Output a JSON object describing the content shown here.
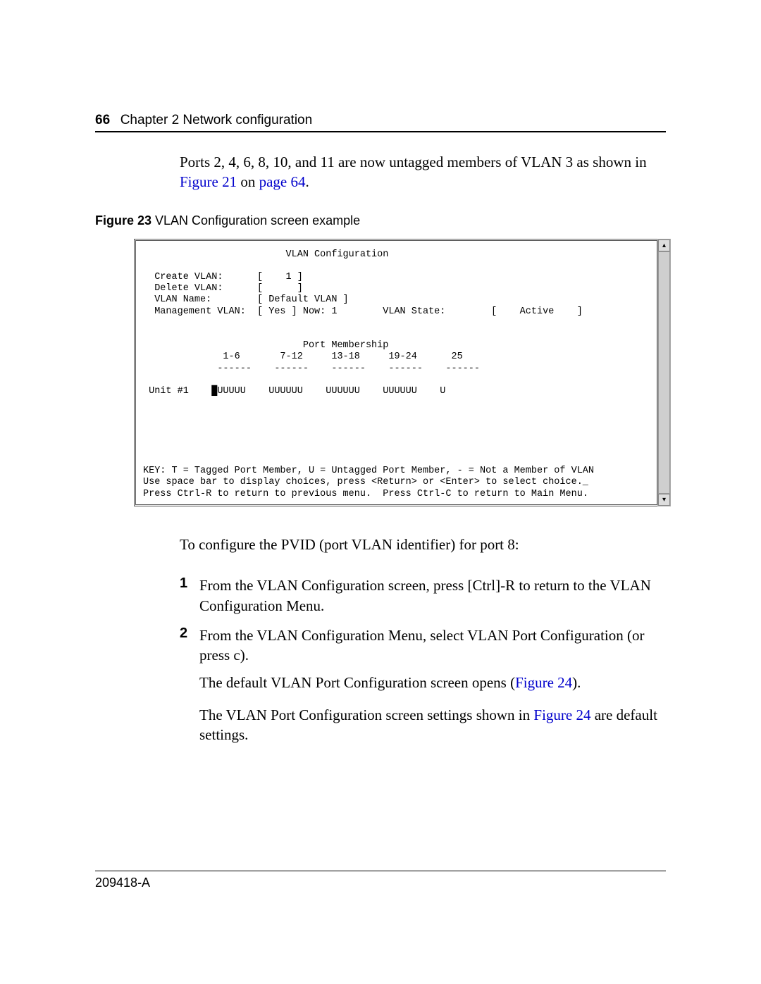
{
  "header": {
    "page_num": "66",
    "chapter": "Chapter 2  Network configuration"
  },
  "intro_para": {
    "line1_a": "Ports 2, 4, 6, 8, 10, and 11 are now untagged members of VLAN 3 as shown in ",
    "xref_fig": "Figure 21",
    "xref_on": " on ",
    "xref_page": "page 64",
    "line1_end": "."
  },
  "figure": {
    "label": "Figure 23",
    "caption": "   VLAN Configuration screen example"
  },
  "terminal_text": "                         VLAN Configuration\n\n  Create VLAN:      [    1 ]\n  Delete VLAN:      [      ]\n  VLAN Name:        [ Default VLAN ]\n  Management VLAN:  [ Yes ] Now: 1        VLAN State:        [    Active    ]\n\n\n                            Port Membership\n              1-6       7-12     13-18     19-24      25\n             ------    ------    ------    ------    ------\n\n Unit #1    █UUUUU    UUUUUU    UUUUUU    UUUUUU    U\n\n\n\n\n\n\nKEY: T = Tagged Port Member, U = Untagged Port Member, - = Not a Member of VLAN\nUse space bar to display choices, press <Return> or <Enter> to select choice._\nPress Ctrl-R to return to previous menu.  Press Ctrl-C to return to Main Menu.",
  "post_fig_para": "To configure the PVID (port VLAN identifier) for port 8:",
  "steps": {
    "s1_num": "1",
    "s1_text": "From the VLAN Configuration screen, press [Ctrl]-R to return to the VLAN Configuration Menu.",
    "s2_num": "2",
    "s2_text": "From the VLAN Configuration Menu, select VLAN Port Configuration (or press c).",
    "s2_follow_a": "The default VLAN Port Configuration screen opens (",
    "s2_follow_link": "Figure 24",
    "s2_follow_b": ").",
    "s2_follow2_a": "The VLAN Port Configuration screen settings shown in ",
    "s2_follow2_link": "Figure 24",
    "s2_follow2_b": " are default settings."
  },
  "doc_id": "209418-A"
}
